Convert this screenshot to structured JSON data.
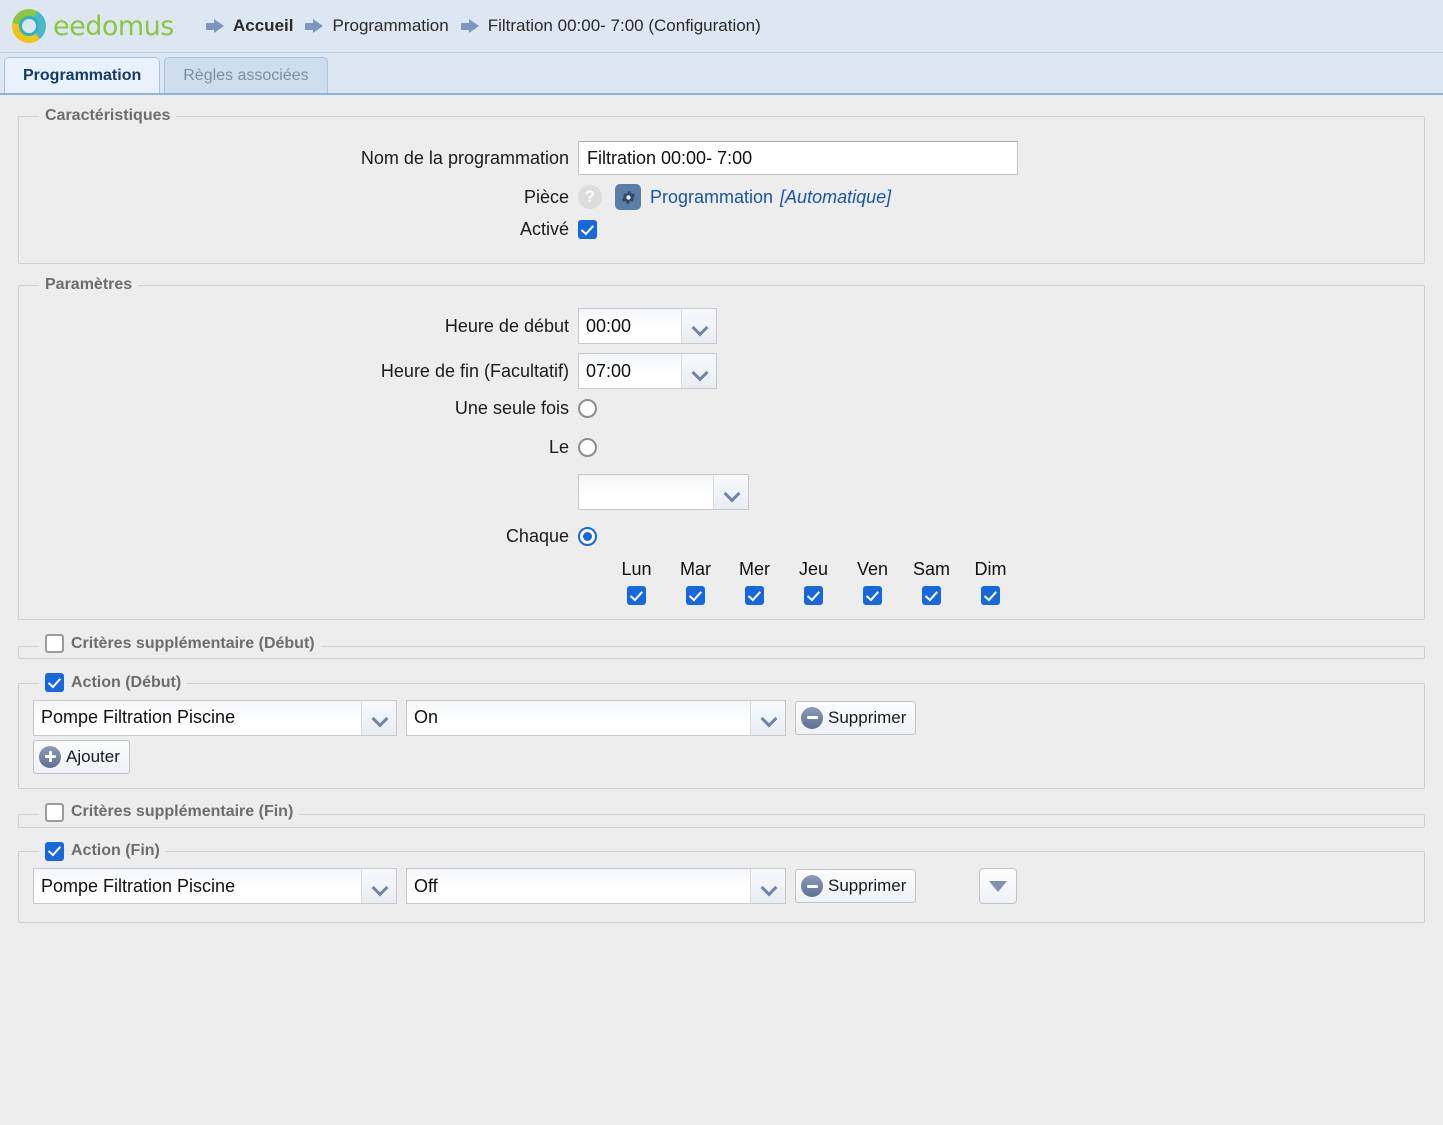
{
  "header": {
    "logo_text": "eedomus",
    "logo_icon": "eedomus-ring-logo",
    "breadcrumb": [
      {
        "label": "Accueil",
        "current": true
      },
      {
        "label": "Programmation",
        "current": false
      },
      {
        "label": "Filtration 00:00- 7:00 (Configuration)",
        "current": false
      }
    ]
  },
  "tabs": [
    {
      "label": "Programmation",
      "active": true
    },
    {
      "label": "Règles associées",
      "active": false
    }
  ],
  "caracteristiques": {
    "legend": "Caractéristiques",
    "nom_label": "Nom de la programmation",
    "nom_value": "Filtration 00:00- 7:00",
    "nom_placeholder": "",
    "piece_label": "Pièce",
    "help_glyph": "?",
    "piece_link": "Programmation",
    "piece_auto": "[Automatique]",
    "active_label": "Activé",
    "active_checked": true
  },
  "parametres": {
    "legend": "Paramètres",
    "heure_debut_label": "Heure de début",
    "heure_debut_value": "00:00",
    "heure_fin_label": "Heure de fin (Facultatif)",
    "heure_fin_value": "07:00",
    "une_seule_fois_label": "Une seule fois",
    "une_seule_fois_selected": false,
    "le_label": "Le",
    "le_selected": false,
    "le_select_value": "",
    "chaque_label": "Chaque",
    "chaque_selected": true,
    "days": [
      {
        "label": "Lun",
        "checked": true
      },
      {
        "label": "Mar",
        "checked": true
      },
      {
        "label": "Mer",
        "checked": true
      },
      {
        "label": "Jeu",
        "checked": true
      },
      {
        "label": "Ven",
        "checked": true
      },
      {
        "label": "Sam",
        "checked": true
      },
      {
        "label": "Dim",
        "checked": true
      }
    ]
  },
  "criteres_debut": {
    "legend": "Critères supplémentaire (Début)",
    "checked": false
  },
  "action_debut": {
    "legend": "Action (Début)",
    "checked": true,
    "device": "Pompe Filtration Piscine",
    "value": "On",
    "supprimer_label": "Supprimer",
    "ajouter_label": "Ajouter"
  },
  "criteres_fin": {
    "legend": "Critères supplémentaire (Fin)",
    "checked": false
  },
  "action_fin": {
    "legend": "Action (Fin)",
    "checked": true,
    "device": "Pompe Filtration Piscine",
    "value": "Off",
    "supprimer_label": "Supprimer",
    "more_icon": "triangle-down-icon"
  },
  "colors": {
    "header_bg": "#dde7f3",
    "page_bg": "#ededed",
    "accent_blue": "#1668dc",
    "link_blue": "#1a55a8",
    "logo_green": "#8cc63f",
    "logo_teal": "#2fb2c9",
    "logo_yellow": "#f0c419",
    "tab_active_bg": "#e9f2fc",
    "tab_inactive_bg": "#cfdeee",
    "legend_gray": "#6d6d6d"
  }
}
